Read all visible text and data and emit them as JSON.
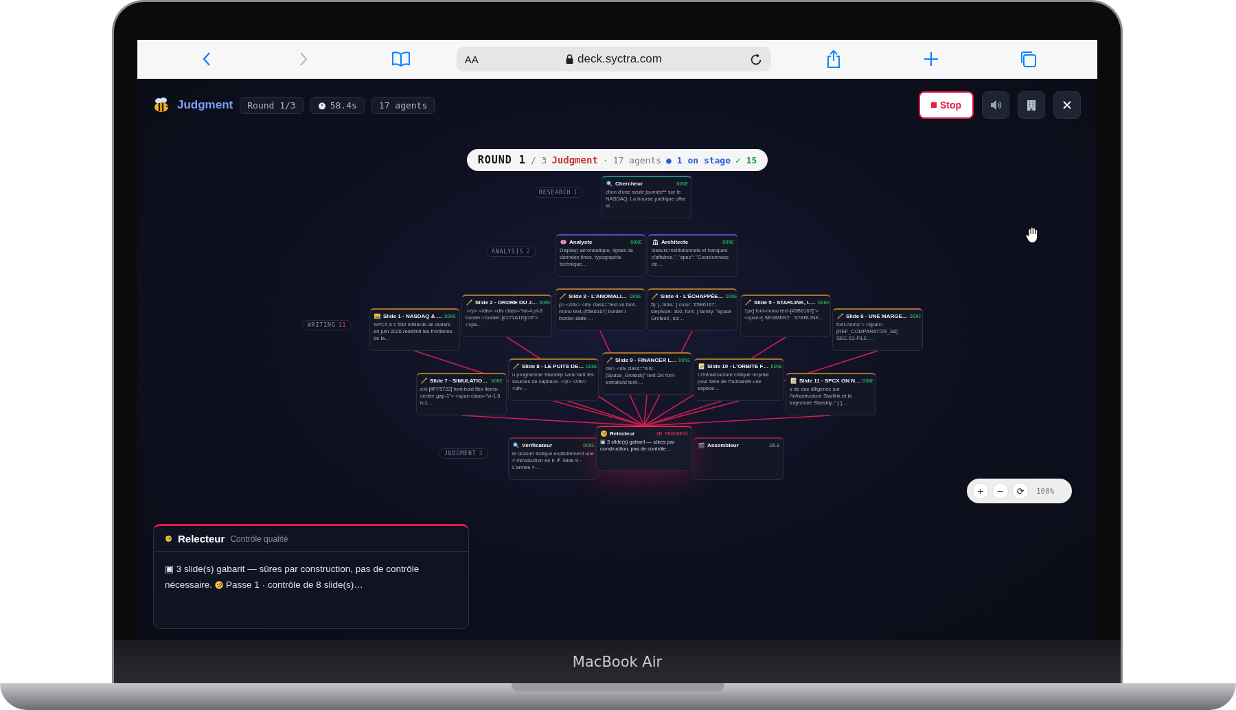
{
  "device": {
    "label": "MacBook Air"
  },
  "browser": {
    "back": {
      "disabled": false
    },
    "forward": {
      "disabled": true
    },
    "text_size": "AA",
    "url": "deck.syctra.com"
  },
  "header": {
    "title": "Judgment",
    "chips": [
      {
        "kind": "plain",
        "text": "Round 1/3"
      },
      {
        "kind": "timer",
        "text": "58.4s"
      },
      {
        "kind": "plain",
        "text": "17 agents"
      }
    ],
    "stop": "Stop"
  },
  "banner": {
    "round": "ROUND 1",
    "total": "/ 3",
    "phase": "Judgment",
    "separator": "·",
    "agents": "17 agents",
    "on_stage": "● 1 on stage",
    "completed": "✓ 15"
  },
  "stages": [
    {
      "label": "RESEARCH",
      "count": "1",
      "nodes": [
        {
          "name": "Chercheur",
          "status": "DONE",
          "kind": "done",
          "snippet": "ction d'une seule journée** sur le NASDAQ. La bourse publique offre al…"
        }
      ]
    },
    {
      "label": "ANALYSIS",
      "count": "2",
      "nodes": [
        {
          "name": "Analyste",
          "status": "DONE",
          "kind": "done",
          "snippet": "Display) aéronautique, lignes de données fines, typographie technique…"
        },
        {
          "name": "Architecte",
          "status": "DONE",
          "kind": "done",
          "snippet": "isseurs institutionnels et banques d'affaires.\", \"spec\": \"Coordonnées de…"
        }
      ]
    },
    {
      "label": "WRITING",
      "count": "11",
      "nodes": [
        {
          "name": "Slide 1 · NASDAQ & …",
          "status": "DONE",
          "kind": "done",
          "snippet": "SPCX à 1 500 milliards de dollars en juin 2026 redéfinit les frontières de la…"
        },
        {
          "name": "Slide 2 · ORDRE DU J…",
          "status": "DONE",
          "kind": "done",
          "snippet": ".</p> </div> <div class=\"mt-4 pt-3 border-t border-[#171A1D]/10\"> <spa…"
        },
        {
          "name": "Slide 3 · L'ANOMALI…",
          "status": "DONE",
          "kind": "done",
          "snippet": "p> </div> <div class=\"text-xs font-mono text-[#5B6167] border-l border-slate-…"
        },
        {
          "name": "Slide 4 · L'ÉCHAPPÉE…",
          "status": "DONE",
          "kind": "done",
          "snippet": "5)' }, ticks: { color: '#5B6167', stepSize: 300, font: { family: 'Space Grotesk', siz…"
        },
        {
          "name": "Slide 5 · STARLINK, L…",
          "status": "DONE",
          "kind": "done",
          "snippet": "1px] font-mono text-[#5B6167]\"> <span>[ SEGMENT : STARLINK…"
        },
        {
          "name": "Slide 6 · UNE MARGE…",
          "status": "DONE",
          "kind": "done",
          "snippet": "font-mono\"> <span> [REF_COMPARATOR_S6] SEC.S1-FILE …"
        },
        {
          "name": "Slide 7 · SIMULATIO…",
          "status": "DONE",
          "kind": "done",
          "snippet": "ext-[#FF5722] font-bold flex items-center gap-1\"> <span class=\"w-1.5 h-1…"
        },
        {
          "name": "Slide 8 · LE PUITS DE…",
          "status": "DONE",
          "kind": "done",
          "snippet": "u programme Starship sans tarir les sources de capitaux. </p> </div> <div…"
        },
        {
          "name": "Slide 9 · FINANCER L…",
          "status": "DONE",
          "kind": "done",
          "snippet": "div> <div class=\"font-[Space_Grotesk]\" text-2xl font-extrabold text-…"
        },
        {
          "name": "Slide 10 · L'ORBITE F…",
          "status": "DONE",
          "kind": "done",
          "snippet": "t l'infrastructure critique requise pour faire de l'humanité une espèce…"
        },
        {
          "name": "Slide 11 · SPCX ON N…",
          "status": "DONE",
          "kind": "done",
          "snippet": "s de due diligence sur l'infrastructure Starlink et la trajectoire Starship.\" } ],…"
        }
      ]
    },
    {
      "label": "JUDGMENT",
      "count": "3",
      "nodes": [
        {
          "name": "Vérificateur",
          "status": "DONE",
          "kind": "done",
          "snippet": "le dossier indique explicitement une « introduction en b ✗ Slide 9 · L'année «…"
        },
        {
          "name": "Relecteur",
          "status": "IN PROGRESS",
          "kind": "running",
          "snippet": "▣ 3 slide(s) gabarit — sûres par construction, pas de contrôle…"
        },
        {
          "name": "Assembleur",
          "status": "IDLE",
          "kind": "idle"
        }
      ]
    }
  ],
  "zoom": {
    "buttons": [
      "+",
      "−",
      "⟳"
    ],
    "percent": "100%"
  },
  "panel": {
    "title": "Relecteur",
    "subtitle": "Contrôle qualité",
    "message": "▣ 3 slide(s) gabarit — sûres par construction, pas de contrôle",
    "message_cont": "nécessaire.",
    "message_end": "Passe 1 · contrôle de 8 slide(s)…"
  }
}
